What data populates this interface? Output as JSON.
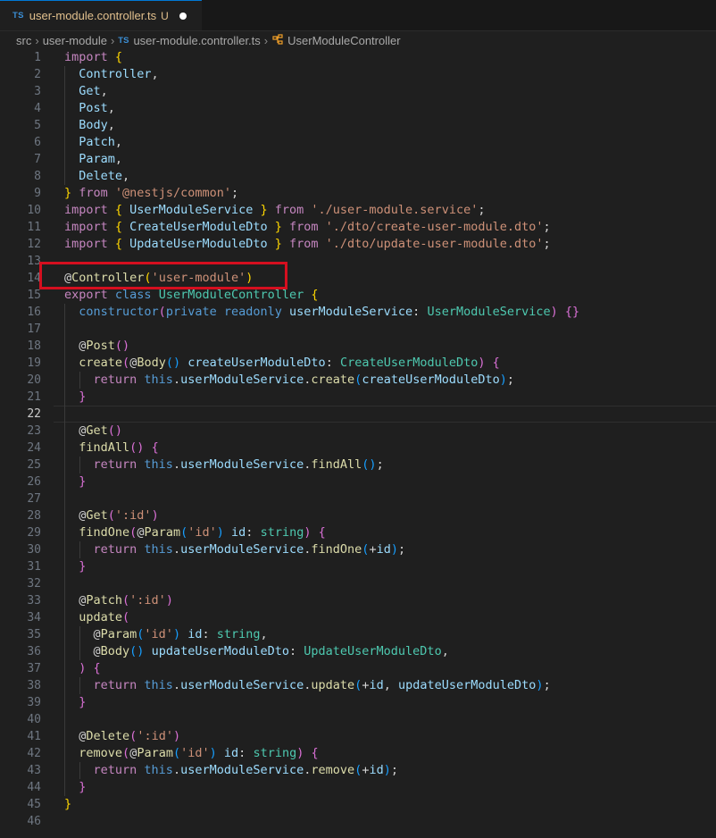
{
  "tab": {
    "lang": "TS",
    "filename": "user-module.controller.ts",
    "status": "U"
  },
  "breadcrumb": {
    "items": [
      "src",
      "user-module",
      "user-module.controller.ts",
      "UserModuleController"
    ],
    "file_lang": "TS"
  },
  "editor": {
    "active_line": 22,
    "lines": [
      {
        "n": "1",
        "t": [
          [
            "import ",
            "kw"
          ],
          [
            "{",
            "p1"
          ]
        ]
      },
      {
        "n": "2",
        "t": [
          [
            "  Controller",
            "id"
          ],
          [
            ",",
            "pl"
          ]
        ]
      },
      {
        "n": "3",
        "t": [
          [
            "  Get",
            "id"
          ],
          [
            ",",
            "pl"
          ]
        ]
      },
      {
        "n": "4",
        "t": [
          [
            "  Post",
            "id"
          ],
          [
            ",",
            "pl"
          ]
        ]
      },
      {
        "n": "5",
        "t": [
          [
            "  Body",
            "id"
          ],
          [
            ",",
            "pl"
          ]
        ]
      },
      {
        "n": "6",
        "t": [
          [
            "  Patch",
            "id"
          ],
          [
            ",",
            "pl"
          ]
        ]
      },
      {
        "n": "7",
        "t": [
          [
            "  Param",
            "id"
          ],
          [
            ",",
            "pl"
          ]
        ]
      },
      {
        "n": "8",
        "t": [
          [
            "  Delete",
            "id"
          ],
          [
            ",",
            "pl"
          ]
        ]
      },
      {
        "n": "9",
        "t": [
          [
            "}",
            "p1"
          ],
          [
            " from ",
            "kw"
          ],
          [
            "'@nestjs/common'",
            "st"
          ],
          [
            ";",
            "pl"
          ]
        ]
      },
      {
        "n": "10",
        "t": [
          [
            "import ",
            "kw"
          ],
          [
            "{ ",
            "p1"
          ],
          [
            "UserModuleService",
            "id"
          ],
          [
            " }",
            "p1"
          ],
          [
            " from ",
            "kw"
          ],
          [
            "'./user-module.service'",
            "st"
          ],
          [
            ";",
            "pl"
          ]
        ]
      },
      {
        "n": "11",
        "t": [
          [
            "import ",
            "kw"
          ],
          [
            "{ ",
            "p1"
          ],
          [
            "CreateUserModuleDto",
            "id"
          ],
          [
            " }",
            "p1"
          ],
          [
            " from ",
            "kw"
          ],
          [
            "'./dto/create-user-module.dto'",
            "st"
          ],
          [
            ";",
            "pl"
          ]
        ]
      },
      {
        "n": "12",
        "t": [
          [
            "import ",
            "kw"
          ],
          [
            "{ ",
            "p1"
          ],
          [
            "UpdateUserModuleDto",
            "id"
          ],
          [
            " }",
            "p1"
          ],
          [
            " from ",
            "kw"
          ],
          [
            "'./dto/update-user-module.dto'",
            "st"
          ],
          [
            ";",
            "pl"
          ]
        ]
      },
      {
        "n": "13",
        "t": []
      },
      {
        "n": "14",
        "t": [
          [
            "@",
            "pl"
          ],
          [
            "Controller",
            "fn"
          ],
          [
            "(",
            "p1"
          ],
          [
            "'user-module'",
            "st"
          ],
          [
            ")",
            "p1"
          ]
        ]
      },
      {
        "n": "15",
        "t": [
          [
            "export ",
            "kw"
          ],
          [
            "class ",
            "kb"
          ],
          [
            "UserModuleController ",
            "ty"
          ],
          [
            "{",
            "p1"
          ]
        ]
      },
      {
        "n": "16",
        "t": [
          [
            "  ",
            "pl"
          ],
          [
            "constructor",
            "kb"
          ],
          [
            "(",
            "p2"
          ],
          [
            "private ",
            "kb"
          ],
          [
            "readonly ",
            "kb"
          ],
          [
            "userModuleService",
            "id"
          ],
          [
            ": ",
            "pl"
          ],
          [
            "UserModuleService",
            "ty"
          ],
          [
            ")",
            "p2"
          ],
          [
            " ",
            "pl"
          ],
          [
            "{}",
            "p2"
          ]
        ]
      },
      {
        "n": "17",
        "t": []
      },
      {
        "n": "18",
        "t": [
          [
            "  @",
            "pl"
          ],
          [
            "Post",
            "fn"
          ],
          [
            "()",
            "p2"
          ]
        ]
      },
      {
        "n": "19",
        "t": [
          [
            "  ",
            "pl"
          ],
          [
            "create",
            "fn"
          ],
          [
            "(",
            "p2"
          ],
          [
            "@",
            "pl"
          ],
          [
            "Body",
            "fn"
          ],
          [
            "()",
            "p3"
          ],
          [
            " ",
            "pl"
          ],
          [
            "createUserModuleDto",
            "id"
          ],
          [
            ": ",
            "pl"
          ],
          [
            "CreateUserModuleDto",
            "ty"
          ],
          [
            ")",
            "p2"
          ],
          [
            " ",
            "pl"
          ],
          [
            "{",
            "p2"
          ]
        ]
      },
      {
        "n": "20",
        "t": [
          [
            "    ",
            "pl"
          ],
          [
            "return ",
            "kw"
          ],
          [
            "this",
            "kb"
          ],
          [
            ".",
            "pl"
          ],
          [
            "userModuleService",
            "id"
          ],
          [
            ".",
            "pl"
          ],
          [
            "create",
            "fn"
          ],
          [
            "(",
            "p3"
          ],
          [
            "createUserModuleDto",
            "id"
          ],
          [
            ")",
            "p3"
          ],
          [
            ";",
            "pl"
          ]
        ]
      },
      {
        "n": "21",
        "t": [
          [
            "  ",
            "pl"
          ],
          [
            "}",
            "p2"
          ]
        ]
      },
      {
        "n": "22",
        "t": []
      },
      {
        "n": "23",
        "t": [
          [
            "  @",
            "pl"
          ],
          [
            "Get",
            "fn"
          ],
          [
            "()",
            "p2"
          ]
        ]
      },
      {
        "n": "24",
        "t": [
          [
            "  ",
            "pl"
          ],
          [
            "findAll",
            "fn"
          ],
          [
            "()",
            "p2"
          ],
          [
            " ",
            "pl"
          ],
          [
            "{",
            "p2"
          ]
        ]
      },
      {
        "n": "25",
        "t": [
          [
            "    ",
            "pl"
          ],
          [
            "return ",
            "kw"
          ],
          [
            "this",
            "kb"
          ],
          [
            ".",
            "pl"
          ],
          [
            "userModuleService",
            "id"
          ],
          [
            ".",
            "pl"
          ],
          [
            "findAll",
            "fn"
          ],
          [
            "()",
            "p3"
          ],
          [
            ";",
            "pl"
          ]
        ]
      },
      {
        "n": "26",
        "t": [
          [
            "  ",
            "pl"
          ],
          [
            "}",
            "p2"
          ]
        ]
      },
      {
        "n": "27",
        "t": []
      },
      {
        "n": "28",
        "t": [
          [
            "  @",
            "pl"
          ],
          [
            "Get",
            "fn"
          ],
          [
            "(",
            "p2"
          ],
          [
            "':id'",
            "st"
          ],
          [
            ")",
            "p2"
          ]
        ]
      },
      {
        "n": "29",
        "t": [
          [
            "  ",
            "pl"
          ],
          [
            "findOne",
            "fn"
          ],
          [
            "(",
            "p2"
          ],
          [
            "@",
            "pl"
          ],
          [
            "Param",
            "fn"
          ],
          [
            "(",
            "p3"
          ],
          [
            "'id'",
            "st"
          ],
          [
            ")",
            "p3"
          ],
          [
            " ",
            "pl"
          ],
          [
            "id",
            "id"
          ],
          [
            ": ",
            "pl"
          ],
          [
            "string",
            "ty"
          ],
          [
            ")",
            "p2"
          ],
          [
            " ",
            "pl"
          ],
          [
            "{",
            "p2"
          ]
        ]
      },
      {
        "n": "30",
        "t": [
          [
            "    ",
            "pl"
          ],
          [
            "return ",
            "kw"
          ],
          [
            "this",
            "kb"
          ],
          [
            ".",
            "pl"
          ],
          [
            "userModuleService",
            "id"
          ],
          [
            ".",
            "pl"
          ],
          [
            "findOne",
            "fn"
          ],
          [
            "(",
            "p3"
          ],
          [
            "+",
            "pl"
          ],
          [
            "id",
            "id"
          ],
          [
            ")",
            "p3"
          ],
          [
            ";",
            "pl"
          ]
        ]
      },
      {
        "n": "31",
        "t": [
          [
            "  ",
            "pl"
          ],
          [
            "}",
            "p2"
          ]
        ]
      },
      {
        "n": "32",
        "t": []
      },
      {
        "n": "33",
        "t": [
          [
            "  @",
            "pl"
          ],
          [
            "Patch",
            "fn"
          ],
          [
            "(",
            "p2"
          ],
          [
            "':id'",
            "st"
          ],
          [
            ")",
            "p2"
          ]
        ]
      },
      {
        "n": "34",
        "t": [
          [
            "  ",
            "pl"
          ],
          [
            "update",
            "fn"
          ],
          [
            "(",
            "p2"
          ]
        ]
      },
      {
        "n": "35",
        "t": [
          [
            "    @",
            "pl"
          ],
          [
            "Param",
            "fn"
          ],
          [
            "(",
            "p3"
          ],
          [
            "'id'",
            "st"
          ],
          [
            ")",
            "p3"
          ],
          [
            " ",
            "pl"
          ],
          [
            "id",
            "id"
          ],
          [
            ": ",
            "pl"
          ],
          [
            "string",
            "ty"
          ],
          [
            ",",
            "pl"
          ]
        ]
      },
      {
        "n": "36",
        "t": [
          [
            "    @",
            "pl"
          ],
          [
            "Body",
            "fn"
          ],
          [
            "()",
            "p3"
          ],
          [
            " ",
            "pl"
          ],
          [
            "updateUserModuleDto",
            "id"
          ],
          [
            ": ",
            "pl"
          ],
          [
            "UpdateUserModuleDto",
            "ty"
          ],
          [
            ",",
            "pl"
          ]
        ]
      },
      {
        "n": "37",
        "t": [
          [
            "  ",
            "pl"
          ],
          [
            ")",
            "p2"
          ],
          [
            " ",
            "pl"
          ],
          [
            "{",
            "p2"
          ]
        ]
      },
      {
        "n": "38",
        "t": [
          [
            "    ",
            "pl"
          ],
          [
            "return ",
            "kw"
          ],
          [
            "this",
            "kb"
          ],
          [
            ".",
            "pl"
          ],
          [
            "userModuleService",
            "id"
          ],
          [
            ".",
            "pl"
          ],
          [
            "update",
            "fn"
          ],
          [
            "(",
            "p3"
          ],
          [
            "+",
            "pl"
          ],
          [
            "id",
            "id"
          ],
          [
            ", ",
            "pl"
          ],
          [
            "updateUserModuleDto",
            "id"
          ],
          [
            ")",
            "p3"
          ],
          [
            ";",
            "pl"
          ]
        ]
      },
      {
        "n": "39",
        "t": [
          [
            "  ",
            "pl"
          ],
          [
            "}",
            "p2"
          ]
        ]
      },
      {
        "n": "40",
        "t": []
      },
      {
        "n": "41",
        "t": [
          [
            "  @",
            "pl"
          ],
          [
            "Delete",
            "fn"
          ],
          [
            "(",
            "p2"
          ],
          [
            "':id'",
            "st"
          ],
          [
            ")",
            "p2"
          ]
        ]
      },
      {
        "n": "42",
        "t": [
          [
            "  ",
            "pl"
          ],
          [
            "remove",
            "fn"
          ],
          [
            "(",
            "p2"
          ],
          [
            "@",
            "pl"
          ],
          [
            "Param",
            "fn"
          ],
          [
            "(",
            "p3"
          ],
          [
            "'id'",
            "st"
          ],
          [
            ")",
            "p3"
          ],
          [
            " ",
            "pl"
          ],
          [
            "id",
            "id"
          ],
          [
            ": ",
            "pl"
          ],
          [
            "string",
            "ty"
          ],
          [
            ")",
            "p2"
          ],
          [
            " ",
            "pl"
          ],
          [
            "{",
            "p2"
          ]
        ]
      },
      {
        "n": "43",
        "t": [
          [
            "    ",
            "pl"
          ],
          [
            "return ",
            "kw"
          ],
          [
            "this",
            "kb"
          ],
          [
            ".",
            "pl"
          ],
          [
            "userModuleService",
            "id"
          ],
          [
            ".",
            "pl"
          ],
          [
            "remove",
            "fn"
          ],
          [
            "(",
            "p3"
          ],
          [
            "+",
            "pl"
          ],
          [
            "id",
            "id"
          ],
          [
            ")",
            "p3"
          ],
          [
            ";",
            "pl"
          ]
        ]
      },
      {
        "n": "44",
        "t": [
          [
            "  ",
            "pl"
          ],
          [
            "}",
            "p2"
          ]
        ]
      },
      {
        "n": "45",
        "t": [
          [
            "}",
            "p1"
          ]
        ]
      },
      {
        "n": "46",
        "t": []
      }
    ]
  },
  "colors": {
    "highlight_box": "#d50f1f",
    "editor_bg": "#1f1f1f",
    "tab_accent": "#0078d4"
  }
}
